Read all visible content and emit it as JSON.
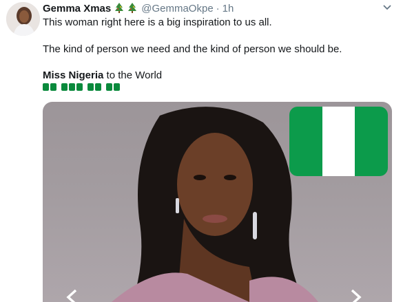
{
  "tweet": {
    "author_name": "Gemma Xmas",
    "handle": "@GemmaOkpe",
    "separator": "·",
    "time": "1h",
    "line1": "This woman right here is a big inspiration to us all.",
    "line2": "The kind of person we need and the kind of person we should be.",
    "line3_bold": "Miss Nigeria",
    "line3_rest": " to the World",
    "heart_color": "#0a8a3c",
    "heart_groups": [
      2,
      3,
      2,
      2
    ]
  },
  "flag_colors": {
    "green": "#0c9b4b",
    "white": "#ffffff"
  },
  "icons": [
    "christmas-tree-icon",
    "chevron-down-icon",
    "green-heart-icon",
    "nigeria-flag-icon",
    "chevron-left-icon",
    "chevron-right-icon"
  ]
}
